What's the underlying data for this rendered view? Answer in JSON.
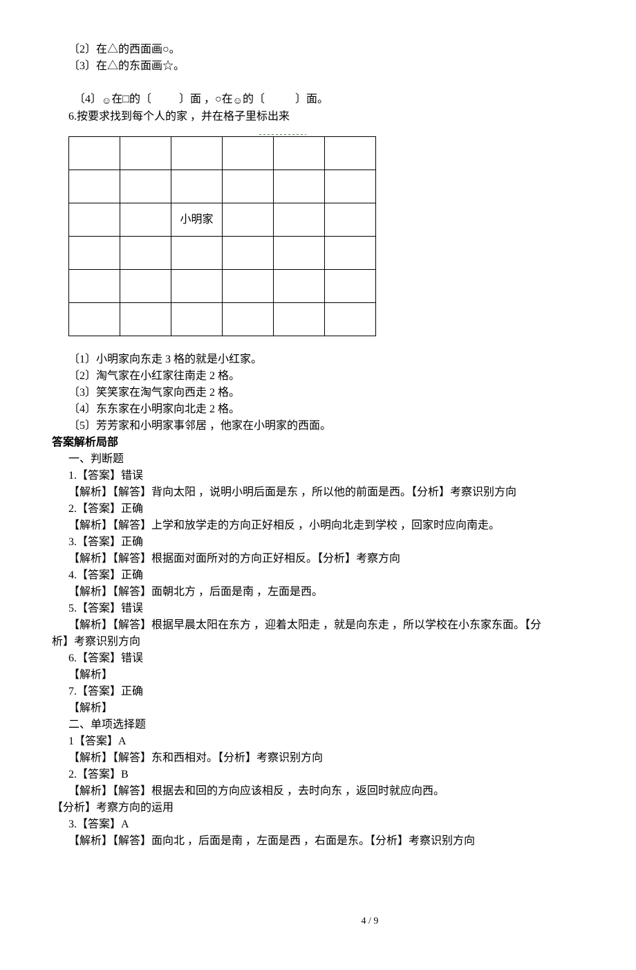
{
  "top": {
    "q2": "〔2〕在△的西面画○。",
    "q3": "〔3〕在△的东面画☆。",
    "q4a": "〔4〕",
    "q4_smiley1": "☺",
    "q4b": "在□的〔          〕面 ，○在",
    "q4_smiley2": "☺",
    "q4c": "的〔           〕面。",
    "q6": "6.按要求找到每个人的家 ，并在格子里标出来"
  },
  "table_cell": "小明家",
  "q6sub": {
    "s1": "〔1〕小明家向东走 3 格的就是小红家。",
    "s2": "〔2〕淘气家在小红家往南走 2 格。",
    "s3": "〔3〕笑笑家在淘气家向西走 2 格。",
    "s4": "〔4〕东东家在小明家向北走 2 格。",
    "s5": "〔5〕芳芳家和小明家事邻居 ，他家在小明家的西面。"
  },
  "answers": {
    "header": "答案解析局部",
    "j_header": "一、判断题",
    "j1a": "1.【答案】错误",
    "j1b": "【解析】【解答】背向太阳 ，说明小明后面是东 ，所以他的前面是西。【分析】考察识别方向",
    "j2a": "2.【答案】正确",
    "j2b": "【解析】【解答】上学和放学走的方向正好相反 ，小明向北走到学校 ，回家时应向南走。",
    "j3a": "3.【答案】正确",
    "j3b": "【解析】【解答】根据面对面所对的方向正好相反。【分析】考察方向",
    "j4a": "4.【答案】正确",
    "j4b": "【解析】【解答】面朝北方 ，后面是南 ，左面是西。",
    "j5a": "5.【答案】错误",
    "j5b": "【解析】【解答】根据早晨太阳在东方 ，迎着太阳走 ，就是向东走 ，所以学校在小东家东面。【分",
    "j5c": "析】考察识别方向",
    "j6a": "6.【答案】错误",
    "j6b": "【解析】",
    "j7a": "7.【答案】正确",
    "j7b": "【解析】",
    "mc_header": "二、单项选择题",
    "m1a": "1【答案】A",
    "m1b": "【解析】【解答】东和西相对。【分析】考察识别方向",
    "m2a": "2.【答案】B",
    "m2b": "【解析】【解答】根据去和回的方向应该相反 ，去时向东 ，返回时就应向西。",
    "m2c": "【分析】考察方向的运用",
    "m3a": "3.【答案】A",
    "m3b": "【解析】【解答】面向北 ，后面是南 ，左面是西 ，右面是东。【分析】考察识别方向"
  },
  "page_num": "4 / 9"
}
